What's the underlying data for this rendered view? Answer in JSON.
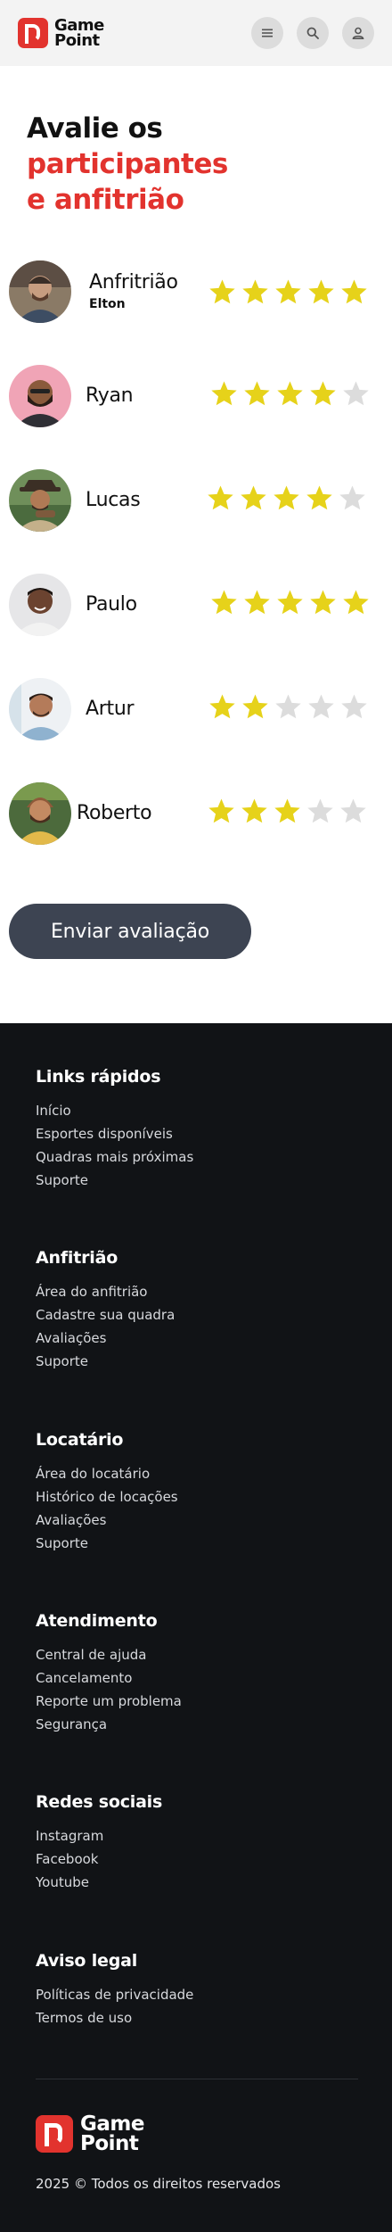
{
  "header": {
    "brand_line1": "Game",
    "brand_line2": "Point",
    "icons": [
      "menu-icon",
      "search-icon",
      "user-icon"
    ]
  },
  "page": {
    "title_part1": "Avalie os ",
    "title_accent": "participantes e anfitrião",
    "accent_color": "#e2332e",
    "star_color": "#e6d21a",
    "star_empty_color": "#dcdcdc"
  },
  "participants": [
    {
      "name": "Anfritrião",
      "subname": "Elton",
      "rating": 5
    },
    {
      "name": "Ryan",
      "rating": 4
    },
    {
      "name": "Lucas",
      "rating": 4
    },
    {
      "name": "Paulo",
      "rating": 5
    },
    {
      "name": "Artur",
      "rating": 2
    },
    {
      "name": "Roberto",
      "rating": 3
    }
  ],
  "submit_label": "Enviar avaliação",
  "footer": {
    "sections": [
      {
        "title": "Links rápidos",
        "links": [
          "Início",
          "Esportes disponíveis",
          "Quadras mais próximas",
          "Suporte"
        ]
      },
      {
        "title": "Anfitrião",
        "links": [
          "Área do anfitrião",
          "Cadastre sua quadra",
          "Avaliações",
          "Suporte"
        ]
      },
      {
        "title": "Locatário",
        "links": [
          "Área do locatário",
          "Histórico de locações",
          "Avaliações",
          "Suporte"
        ]
      },
      {
        "title": "Atendimento",
        "links": [
          "Central de ajuda",
          "Cancelamento",
          "Reporte um problema",
          "Segurança"
        ]
      },
      {
        "title": "Redes sociais",
        "links": [
          "Instagram",
          "Facebook",
          "Youtube"
        ]
      },
      {
        "title": "Aviso legal",
        "links": [
          "Políticas de privacidade",
          "Termos de uso"
        ]
      }
    ],
    "brand_line1": "Game",
    "brand_line2": "Point",
    "copyright": "2025 © Todos os direitos reservados"
  }
}
